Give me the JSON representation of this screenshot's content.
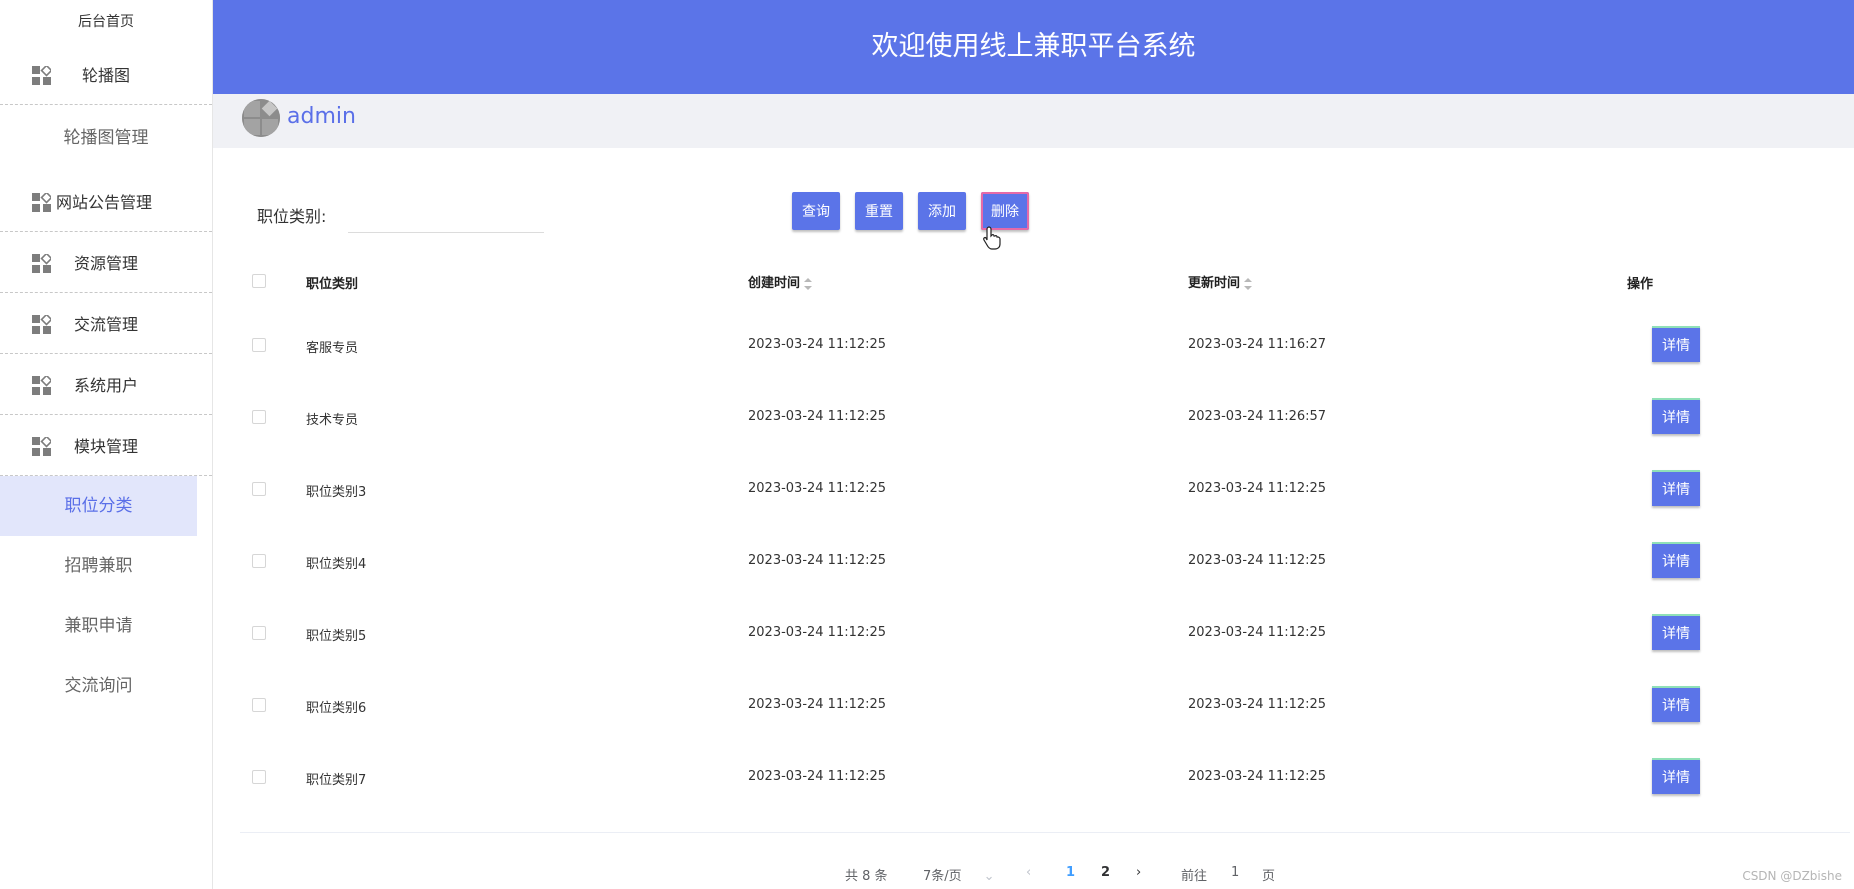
{
  "sidebar": {
    "home": "后台首页",
    "groups": [
      {
        "label": "轮播图",
        "icon": "grid-icon"
      },
      {
        "label": "网站公告管理",
        "icon": "grid-icon"
      },
      {
        "label": "资源管理",
        "icon": "grid-icon"
      },
      {
        "label": "交流管理",
        "icon": "grid-icon"
      },
      {
        "label": "系统用户",
        "icon": "grid-icon"
      },
      {
        "label": "模块管理",
        "icon": "grid-icon"
      }
    ],
    "carousel_sub": "轮播图管理",
    "module_items": [
      {
        "label": "职位分类",
        "active": true
      },
      {
        "label": "招聘兼职",
        "active": false
      },
      {
        "label": "兼职申请",
        "active": false
      },
      {
        "label": "交流询问",
        "active": false
      }
    ]
  },
  "header": {
    "title": "欢迎使用线上兼职平台系统",
    "color": "#5b74e8"
  },
  "user": {
    "name": "admin"
  },
  "filter": {
    "label": "职位类别:",
    "value": ""
  },
  "toolbar": {
    "query": "查询",
    "reset": "重置",
    "add": "添加",
    "delete": "删除"
  },
  "table": {
    "headers": {
      "category": "职位类别",
      "created": "创建时间",
      "updated": "更新时间",
      "actions": "操作"
    },
    "rows": [
      {
        "category": "客服专员",
        "created": "2023-03-24 11:12:25",
        "updated": "2023-03-24 11:16:27",
        "action": "详情"
      },
      {
        "category": "技术专员",
        "created": "2023-03-24 11:12:25",
        "updated": "2023-03-24 11:26:57",
        "action": "详情"
      },
      {
        "category": "职位类别3",
        "created": "2023-03-24 11:12:25",
        "updated": "2023-03-24 11:12:25",
        "action": "详情"
      },
      {
        "category": "职位类别4",
        "created": "2023-03-24 11:12:25",
        "updated": "2023-03-24 11:12:25",
        "action": "详情"
      },
      {
        "category": "职位类别5",
        "created": "2023-03-24 11:12:25",
        "updated": "2023-03-24 11:12:25",
        "action": "详情"
      },
      {
        "category": "职位类别6",
        "created": "2023-03-24 11:12:25",
        "updated": "2023-03-24 11:12:25",
        "action": "详情"
      },
      {
        "category": "职位类别7",
        "created": "2023-03-24 11:12:25",
        "updated": "2023-03-24 11:12:25",
        "action": "详情"
      }
    ]
  },
  "pagination": {
    "total": "共 8 条",
    "page_size": "7条/页",
    "pages": [
      "1",
      "2"
    ],
    "current": "1",
    "goto_prefix": "前往",
    "goto_value": "1",
    "goto_suffix": "页"
  },
  "watermark": "CSDN @DZbishe"
}
